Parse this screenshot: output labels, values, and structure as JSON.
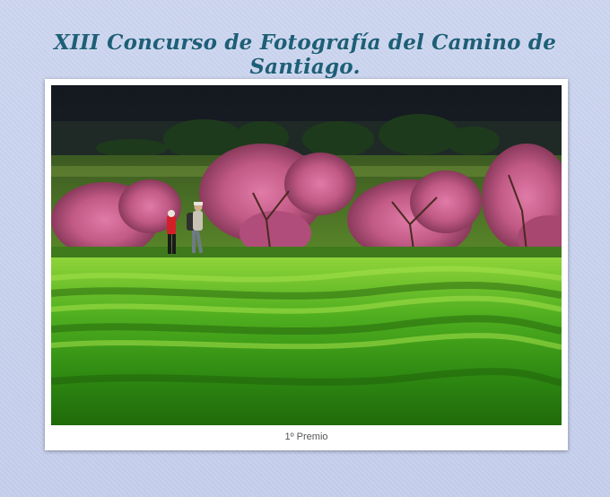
{
  "page": {
    "title": "XIII Concurso de Fotografía del Camino de Santiago."
  },
  "gallery": {
    "caption": "1º Premio"
  },
  "colors": {
    "background": "#c9d3ee",
    "title": "#1d5f77",
    "card": "#ffffff"
  }
}
